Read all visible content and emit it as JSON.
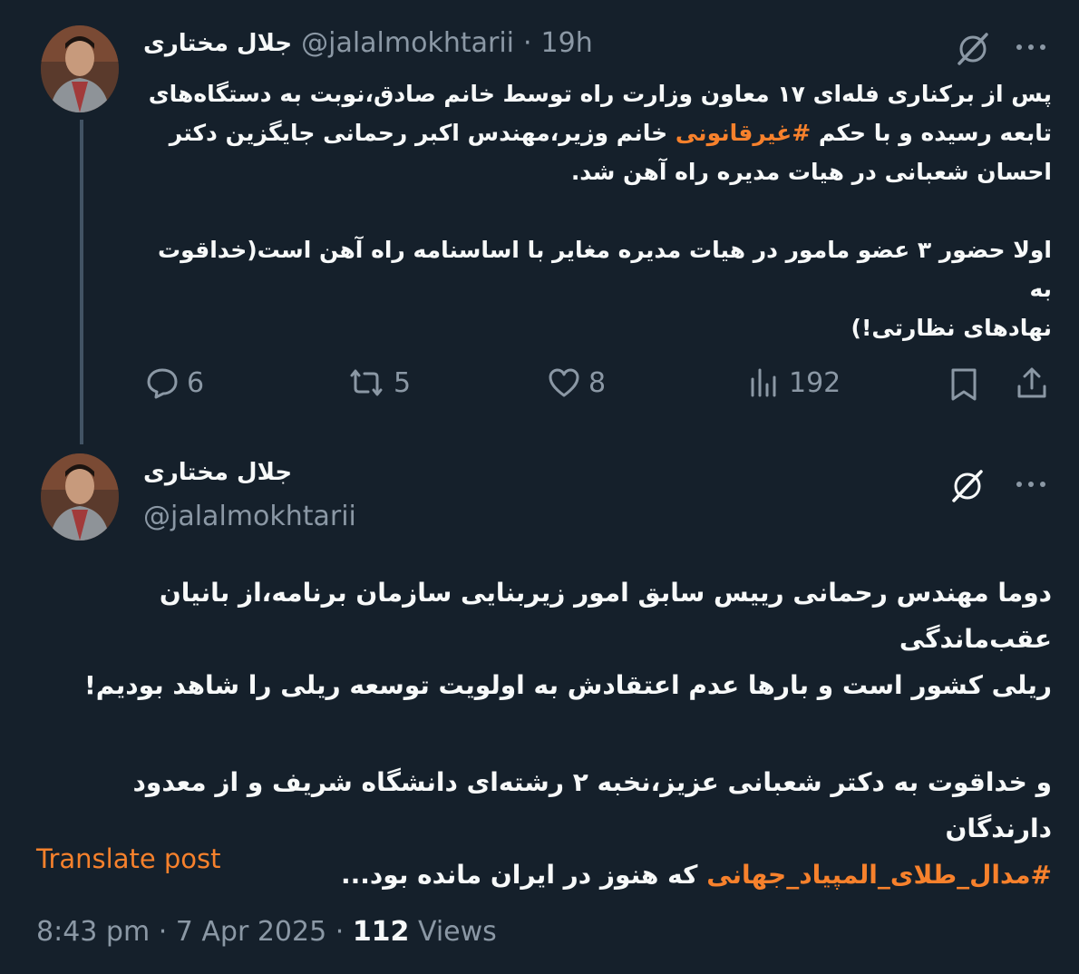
{
  "tweet1": {
    "name": "جلال مختاری",
    "handle": "@jalalmokhtarii",
    "separator": "·",
    "time": "19h",
    "text_lines": [
      "پس از برکناری فله‌ای ۱۷ معاون وزارت راه توسط خانم صادق،نوبت به دستگاه‌های",
      "خانم وزیر،مهندس اکبر رحمانی جایگزین دکتر",
      "احسان شعبانی در هیات مدیره راه آهن شد.",
      "",
      "اولا حضور ۳ عضو مامور در هیات مدیره مغایر با اساسنامه راه آهن است(خداقوت به",
      "نهادهای نظارتی!)"
    ],
    "line2_prefix": "تابعه رسیده و با حکم",
    "hashtag": "#غیرقانونی",
    "actions": {
      "replies": "6",
      "reposts": "5",
      "likes": "8",
      "views": "192"
    }
  },
  "tweet2": {
    "name": "جلال مختاری",
    "handle": "@jalalmokhtarii",
    "text_lines": [
      "دوما مهندس رحمانی رییس سابق امور زیربنایی سازمان برنامه،از بانیان عقب‌ماندگی",
      "ریلی کشور است و بارها عدم اعتقادش به اولویت توسعه ریلی را شاهد بودیم!",
      "",
      "و خداقوت به دکتر شعبانی عزیز،نخبه ۲ رشته‌ای دانشگاه شریف و از معدود دارندگان"
    ],
    "last_line_suffix": "که هنوز در ایران مانده بود...",
    "hashtag": "#مدال_طلای_المپیاد_جهانی",
    "translate": "Translate post",
    "timestamp": "8:43 pm · 7 Apr 2025 ·",
    "views_count": "112",
    "views_label": "Views"
  },
  "colors": {
    "background": "#15202b",
    "text": "#f7f9f9",
    "muted": "#8b98a5",
    "accent": "#f7812c"
  },
  "icons": [
    "grok-icon",
    "more-icon",
    "reply-icon",
    "repost-icon",
    "like-icon",
    "views-icon",
    "bookmark-icon",
    "share-icon"
  ]
}
